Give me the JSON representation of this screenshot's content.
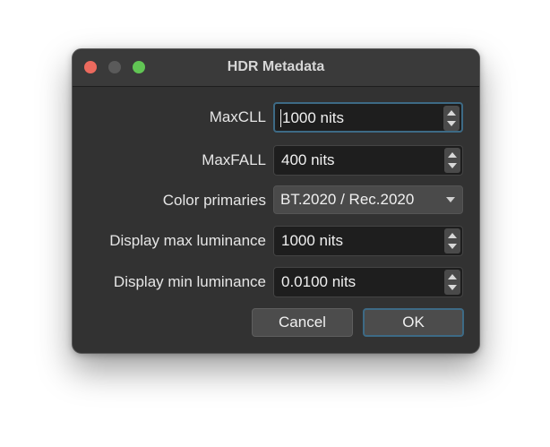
{
  "window": {
    "title": "HDR Metadata",
    "traffic_lights": [
      "close",
      "minimize",
      "zoom"
    ]
  },
  "fields": [
    {
      "label": "MaxCLL",
      "value": "1000 nits",
      "type": "spinbox",
      "focused": true
    },
    {
      "label": "MaxFALL",
      "value": "400 nits",
      "type": "spinbox"
    },
    {
      "label": "Color primaries",
      "value": "BT.2020 / Rec.2020",
      "type": "dropdown"
    },
    {
      "label": "Display max luminance",
      "value": "1000 nits",
      "type": "spinbox"
    },
    {
      "label": "Display min luminance",
      "value": "0.0100 nits",
      "type": "spinbox"
    }
  ],
  "buttons": {
    "cancel": "Cancel",
    "ok": "OK"
  },
  "colors": {
    "window_bg": "#323232",
    "field_bg": "#1e1e1e",
    "focus_ring": "#3d6a85",
    "close": "#ec6a5e",
    "zoom": "#61c554"
  }
}
